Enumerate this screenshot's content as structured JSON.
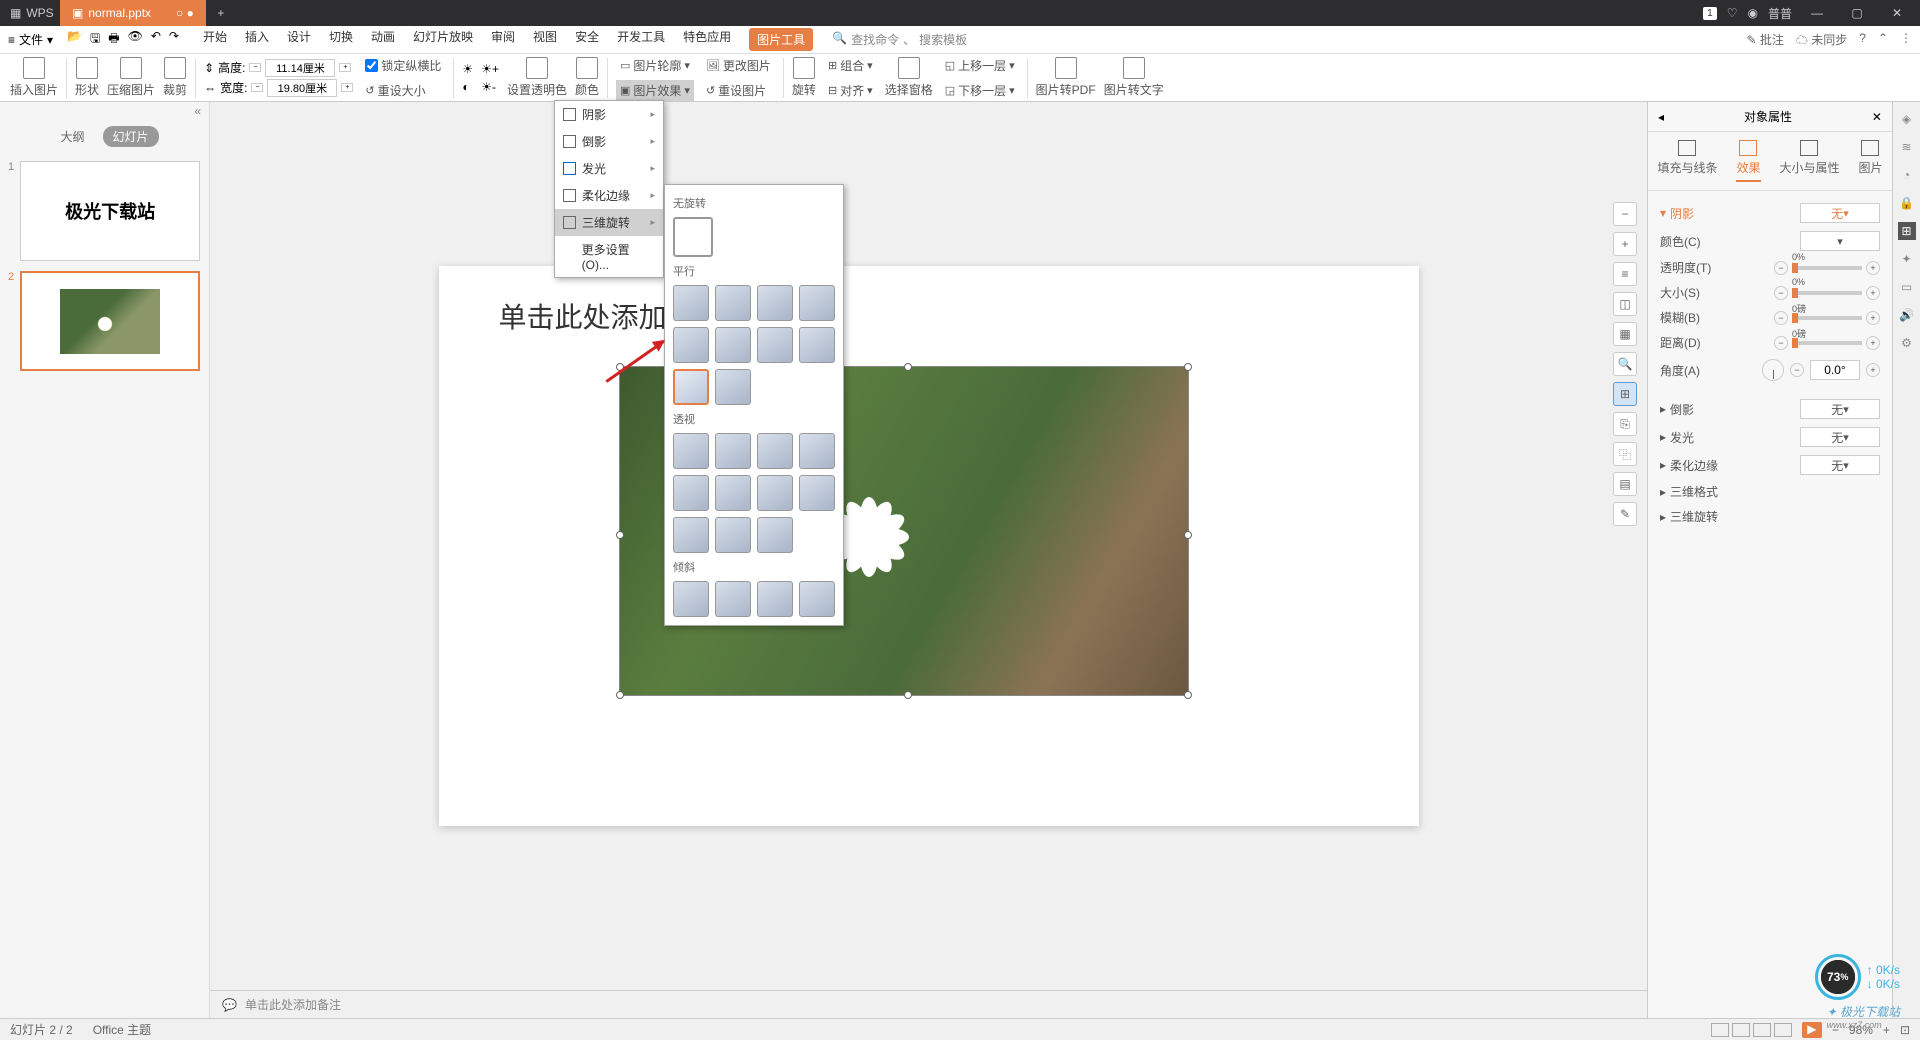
{
  "titlebar": {
    "app": "WPS",
    "tabname": "normal.pptx",
    "badge": "1",
    "user": "普普"
  },
  "menubar": {
    "file": "文件",
    "items": [
      "开始",
      "插入",
      "设计",
      "切换",
      "动画",
      "幻灯片放映",
      "审阅",
      "视图",
      "安全",
      "开发工具",
      "特色应用",
      "图片工具"
    ],
    "active_index": 11,
    "search_cmd": "查找命令",
    "search_tpl": "搜索模板",
    "annotate": "批注",
    "sync": "未同步"
  },
  "ribbon": {
    "insert_pic": "插入图片",
    "shape": "形状",
    "compress": "压缩图片",
    "crop": "裁剪",
    "height_label": "高度:",
    "height_val": "11.14厘米",
    "width_label": "宽度:",
    "width_val": "19.80厘米",
    "lock_ratio": "锁定纵横比",
    "reset_size": "重设大小",
    "set_trans": "设置透明色",
    "color": "颜色",
    "outline": "图片轮廓",
    "effect": "图片效果",
    "change": "更改图片",
    "reset": "重设图片",
    "rotate": "旋转",
    "group": "组合",
    "align": "对齐",
    "select_pane": "选择窗格",
    "up_layer": "上移一层",
    "down_layer": "下移一层",
    "pic_pdf": "图片转PDF",
    "pic_text": "图片转文字"
  },
  "slide_panel": {
    "outline": "大纲",
    "slides": "幻灯片",
    "thumb1_text": "极光下载站"
  },
  "canvas": {
    "title": "单击此处添加标题",
    "notes": "单击此处添加备注"
  },
  "effect_menu": {
    "shadow": "阴影",
    "reflection": "倒影",
    "glow": "发光",
    "soft_edge": "柔化边缘",
    "rotation_3d": "三维旋转",
    "more": "更多设置(O)..."
  },
  "submenu": {
    "no_rotate": "无旋转",
    "parallel": "平行",
    "perspective": "透视",
    "oblique": "倾斜"
  },
  "prop": {
    "title": "对象属性",
    "tab_fill": "填充与线条",
    "tab_effect": "效果",
    "tab_size": "大小与属性",
    "tab_pic": "图片",
    "shadow": "阴影",
    "none": "无",
    "color": "颜色(C)",
    "transparency": "透明度(T)",
    "size": "大小(S)",
    "blur": "模糊(B)",
    "distance": "距离(D)",
    "angle": "角度(A)",
    "pct0": "0%",
    "pound0": "0磅",
    "deg0": "0.0°",
    "reflection": "倒影",
    "glow": "发光",
    "soft_edge": "柔化边缘",
    "format_3d": "三维格式",
    "rotate_3d": "三维旋转"
  },
  "statusbar": {
    "slide": "幻灯片 2 / 2",
    "theme": "Office 主题",
    "zoom": "98%"
  },
  "perf": {
    "pct": "73",
    "unit": "%",
    "up": "0K/s",
    "down": "0K/s"
  },
  "watermark": "极光下载站"
}
